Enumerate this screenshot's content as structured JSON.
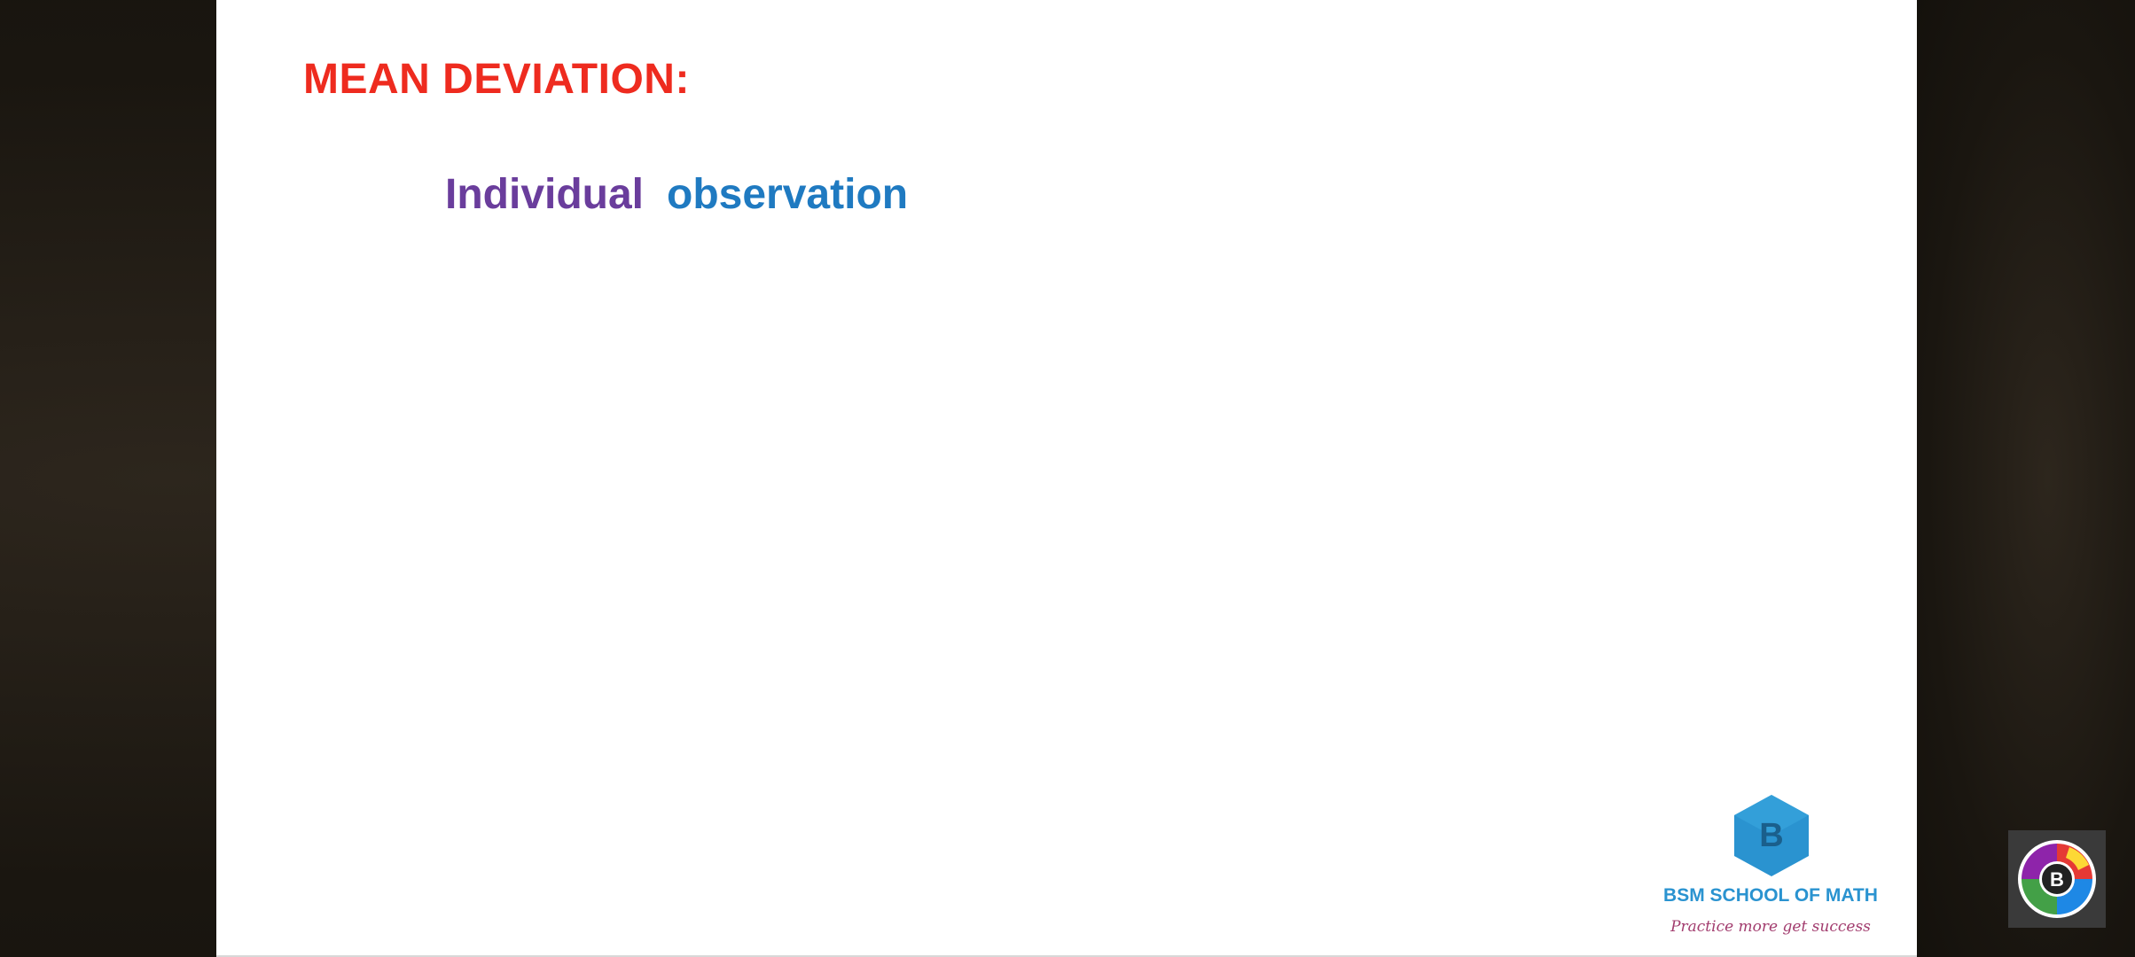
{
  "slide": {
    "title": "MEAN DEVIATION:",
    "subtitle_word1": "Individual",
    "subtitle_word2": "observation"
  },
  "logo": {
    "letter": "B",
    "brand": "BSM SCHOOL OF MATH",
    "tagline": "Practice more get success"
  },
  "corner_badge": {
    "letter": "B"
  },
  "colors": {
    "title": "#ee2b1f",
    "subtitle_word1": "#6a3d9c",
    "subtitle_word2": "#1f7ac1",
    "logo_hex": "#2a93d0",
    "tagline": "#a23c6e"
  }
}
